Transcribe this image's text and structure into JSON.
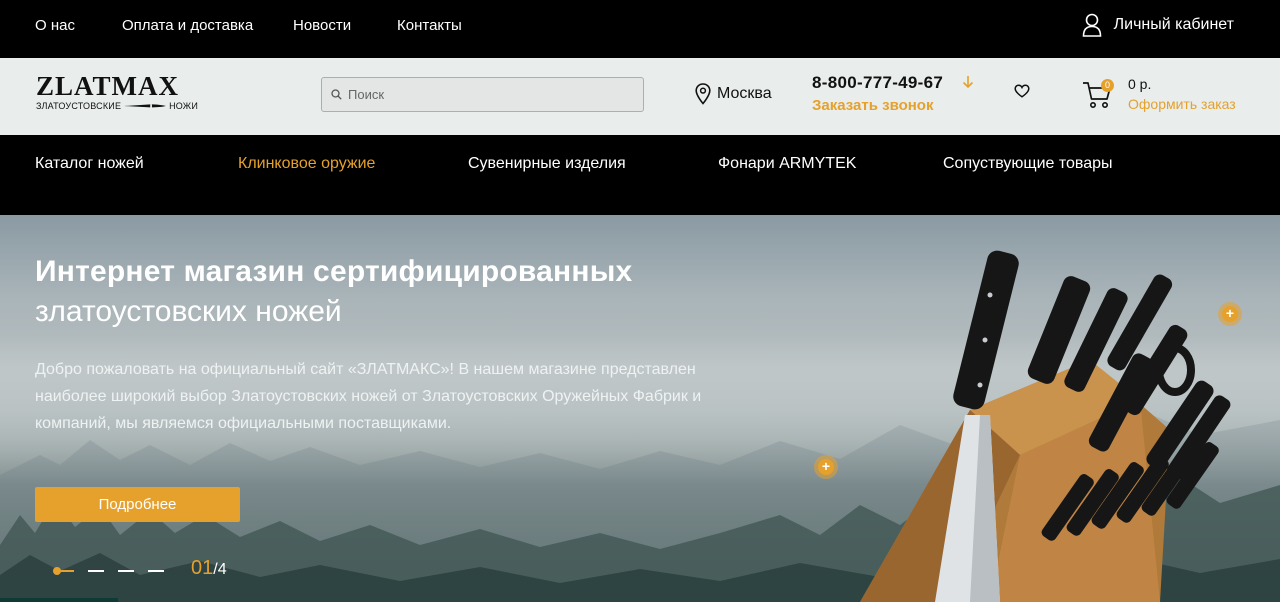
{
  "topbar": {
    "links": [
      "О нас",
      "Оплата и доставка",
      "Новости",
      "Контакты"
    ],
    "account_label": "Личный кабинет",
    "account_icon": "user-icon"
  },
  "header": {
    "logo": {
      "word": "ZLATMAX",
      "sub_left": "ЗЛАТОУСТОВСКИЕ",
      "sub_right": "НОЖИ"
    },
    "search": {
      "placeholder": "Поиск",
      "icon": "search-icon"
    },
    "city": "Москва",
    "phone": "8-800-777-49-67",
    "callback": "Заказать звонок",
    "cart": {
      "count": "0",
      "sum": "0 р.",
      "checkout": "Оформить заказ"
    },
    "colors": {
      "accent": "#e5a12c",
      "header_bg": "#e9edec"
    }
  },
  "categories": [
    {
      "label": "Каталог ножей",
      "active": false
    },
    {
      "label": "Клинковое оружие",
      "active": true
    },
    {
      "label": "Сувенирные изделия",
      "active": false
    },
    {
      "label": "Фонари ARMYTEK",
      "active": false
    },
    {
      "label": "Сопуствующие товары",
      "active": false
    }
  ],
  "hero": {
    "title_bold": "Интернет магазин сертифицированных",
    "title_light": "златоустовских ножей",
    "text": "Добро пожаловать на официальный сайт «ЗЛАТМАКС»! В нашем магазине представлен наиболее широкий выбор Златоустовских ножей от Златоустовских Оружейных Фабрик и компаний, мы являемся официальными поставщиками.",
    "button": "Подробнее",
    "slide_current": "01",
    "slide_total": "/4",
    "slides_count": 4,
    "active_slide": 1
  }
}
